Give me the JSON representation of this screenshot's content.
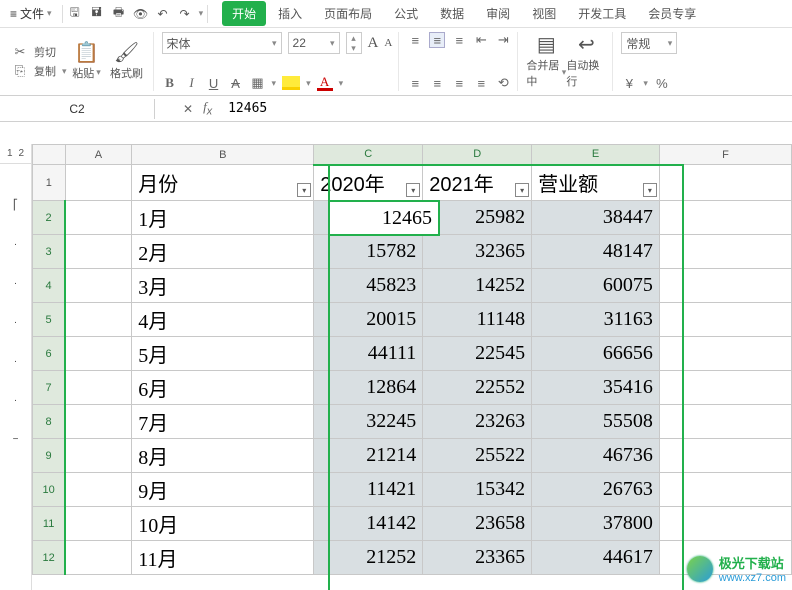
{
  "menubar": {
    "file_label": "文件",
    "tabs": [
      "开始",
      "插入",
      "页面布局",
      "公式",
      "数据",
      "审阅",
      "视图",
      "开发工具",
      "会员专享"
    ],
    "active_tab_index": 0
  },
  "clipboard": {
    "cut": "剪切",
    "copy": "复制",
    "paste": "粘贴",
    "format_painter": "格式刷"
  },
  "font": {
    "name": "宋体",
    "size": "22",
    "bold_hint": "B",
    "italic_hint": "I",
    "underline_hint": "U",
    "bigA": "A",
    "smallA": "A"
  },
  "align": {
    "merge_center": "合并居中",
    "wrap": "自动换行"
  },
  "number": {
    "general": "常规",
    "currency": "¥",
    "percent": "%"
  },
  "namebox": "C2",
  "formula_value": "12465",
  "column_letters": [
    "A",
    "B",
    "C",
    "D",
    "E",
    "F"
  ],
  "row_numbers": [
    1,
    2,
    3,
    4,
    5,
    6,
    7,
    8,
    9,
    10,
    11,
    12
  ],
  "headers": {
    "b": "月份",
    "c": "2020年",
    "d": "2021年",
    "e": "营业额"
  },
  "rows": [
    {
      "b": "1月",
      "c": "12465",
      "d": "25982",
      "e": "38447"
    },
    {
      "b": "2月",
      "c": "15782",
      "d": "32365",
      "e": "48147"
    },
    {
      "b": "3月",
      "c": "45823",
      "d": "14252",
      "e": "60075"
    },
    {
      "b": "4月",
      "c": "20015",
      "d": "11148",
      "e": "31163"
    },
    {
      "b": "5月",
      "c": "44111",
      "d": "22545",
      "e": "66656"
    },
    {
      "b": "6月",
      "c": "12864",
      "d": "22552",
      "e": "35416"
    },
    {
      "b": "7月",
      "c": "32245",
      "d": "23263",
      "e": "55508"
    },
    {
      "b": "8月",
      "c": "21214",
      "d": "25522",
      "e": "46736"
    },
    {
      "b": "9月",
      "c": "11421",
      "d": "15342",
      "e": "26763"
    },
    {
      "b": "10月",
      "c": "14142",
      "d": "23658",
      "e": "37800"
    },
    {
      "b": "11月",
      "c": "21252",
      "d": "23365",
      "e": "44617"
    }
  ],
  "outline_levels": [
    "1",
    "2"
  ],
  "watermark": {
    "name": "极光下载站",
    "url": "www.xz7.com"
  }
}
